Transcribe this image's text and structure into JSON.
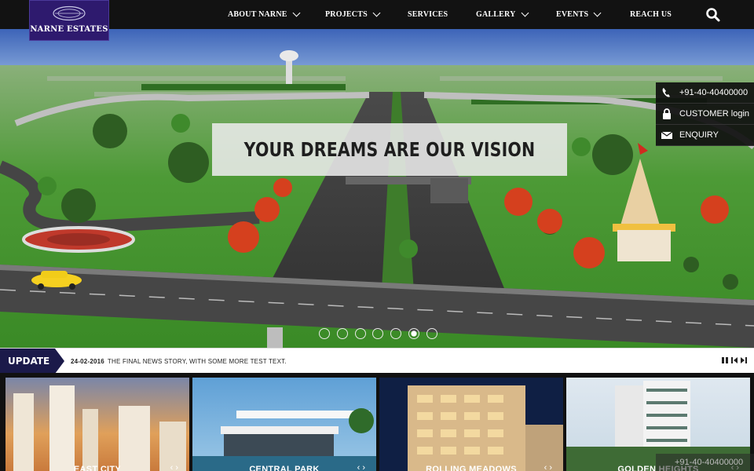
{
  "brand": {
    "name": "NARNE ESTATES",
    "mark_text": "narne"
  },
  "nav": {
    "items": [
      {
        "label": "ABOUT NARNE",
        "dropdown": true
      },
      {
        "label": "PROJECTS",
        "dropdown": true
      },
      {
        "label": "SERVICES",
        "dropdown": false
      },
      {
        "label": "GALLERY",
        "dropdown": true
      },
      {
        "label": "EVENTS",
        "dropdown": true
      },
      {
        "label": "REACH US",
        "dropdown": false
      }
    ],
    "search_icon": "search-icon"
  },
  "hero": {
    "tagline": "YOUR DREAMS ARE OUR VISION",
    "slide_count": 7,
    "active_slide": 6
  },
  "side_panel": {
    "phone": "+91-40-40400000",
    "customer_login": "CUSTOMER login",
    "enquiry": "ENQUIRY"
  },
  "ticker": {
    "label": "UPDATE",
    "date": "24-02-2016",
    "text": "THE FINAL NEWS STORY, WITH SOME MORE TEST TEXT."
  },
  "projects": [
    {
      "title": "EAST CITY"
    },
    {
      "title": "CENTRAL PARK"
    },
    {
      "title": "ROLLING MEADOWS"
    },
    {
      "title": "GOLDEN HEIGHTS"
    }
  ],
  "colors": {
    "brand_purple": "#2e1a6e",
    "nav_bg": "#121212",
    "update_tag": "#1b1a4a"
  }
}
